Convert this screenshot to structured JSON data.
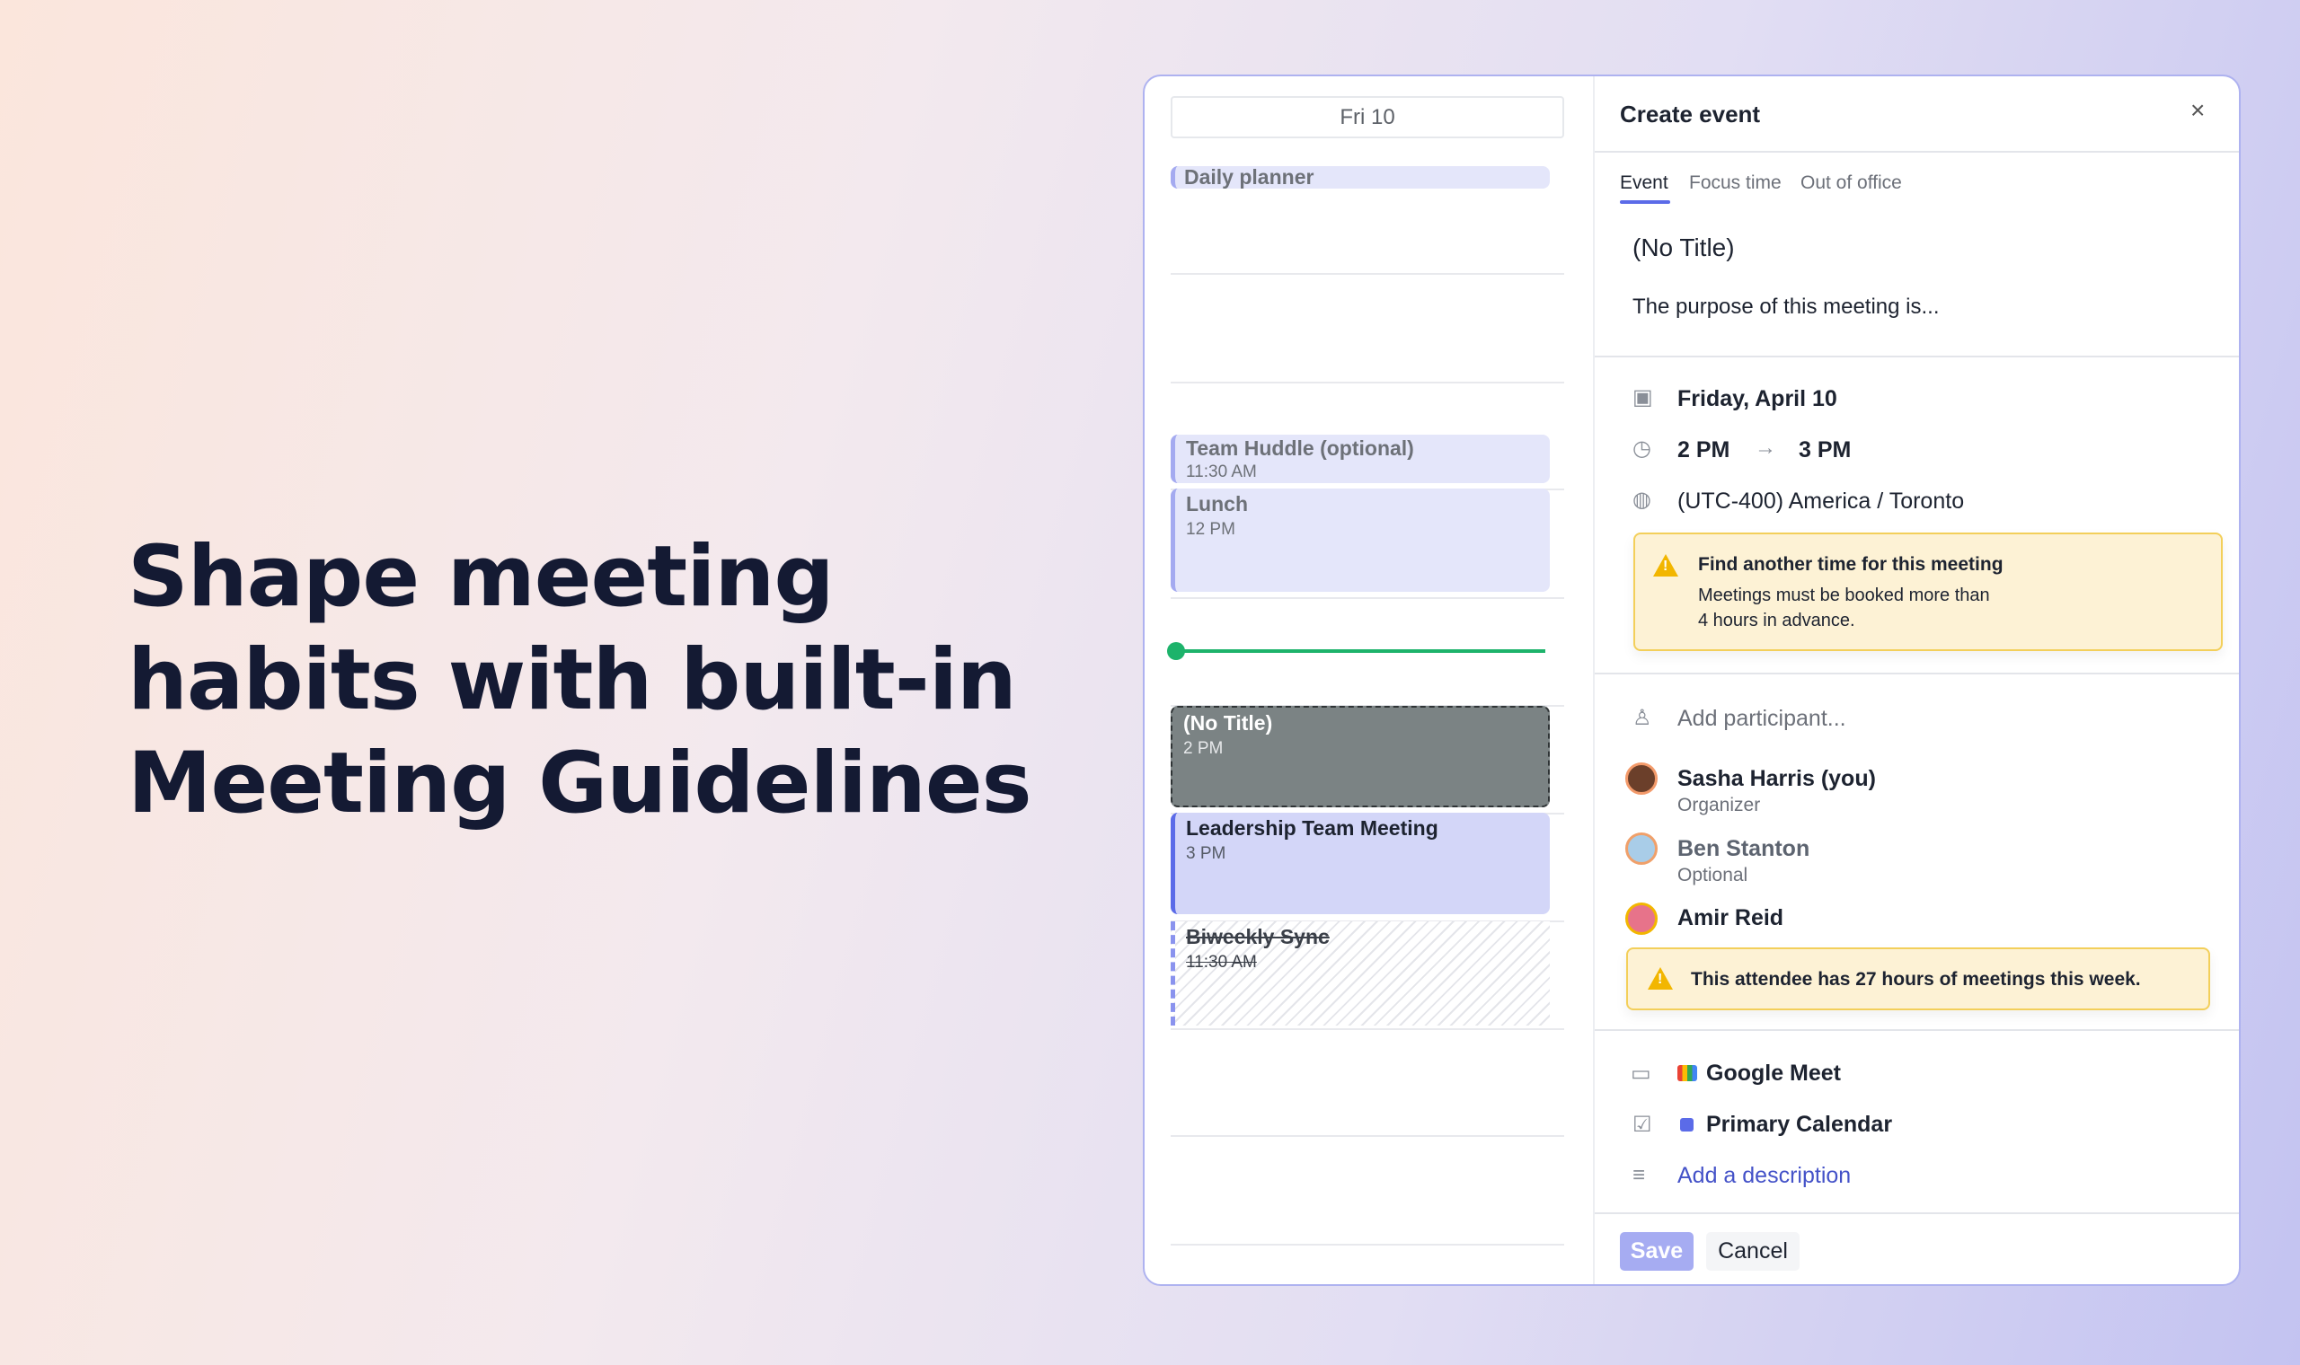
{
  "headline": [
    "Shape meeting",
    "habits with built-in",
    "Meeting Guidelines"
  ],
  "calendar": {
    "day_label": "Fri 10",
    "events": [
      {
        "title": "Daily planner"
      },
      {
        "title": "Team Huddle (optional)",
        "time": "11:30 AM"
      },
      {
        "title": "Lunch",
        "time": "12 PM"
      },
      {
        "title": "(No Title)",
        "time": "2 PM"
      },
      {
        "title": "Leadership Team Meeting",
        "time": "3 PM"
      },
      {
        "title": "Biweekly Sync",
        "time": "11:30 AM",
        "declined": true
      }
    ]
  },
  "dialog": {
    "title": "Create event",
    "close_icon": "close-icon",
    "tabs": [
      {
        "label": "Event",
        "active": true
      },
      {
        "label": "Focus time"
      },
      {
        "label": "Out of office"
      }
    ],
    "event_title": "(No Title)",
    "purpose": "The purpose of this meeting is...",
    "date": "Friday, April 10",
    "start_time": "2 PM",
    "end_time": "3 PM",
    "timezone": "(UTC-400) America / Toronto",
    "time_warning": {
      "title": "Find another time for this meeting",
      "line1": "Meetings must be booked more than",
      "line2": "4 hours in advance."
    },
    "add_participant_placeholder": "Add participant...",
    "participants": [
      {
        "name": "Sasha Harris (you)",
        "role": "Organizer"
      },
      {
        "name": "Ben Stanton",
        "role": "Optional"
      },
      {
        "name": "Amir Reid",
        "role": ""
      }
    ],
    "attendee_warning": "This attendee has 27 hours of meetings this week.",
    "conferencing": "Google Meet",
    "calendar": "Primary Calendar",
    "add_description": "Add a description",
    "save_label": "Save",
    "cancel_label": "Cancel"
  },
  "colors": {
    "accent": "#5b6be8",
    "warning_bg": "#fdf2d5",
    "warning_border": "#f3cf5a",
    "now_line": "#1db36b",
    "save_bg": "#a6acf2"
  }
}
